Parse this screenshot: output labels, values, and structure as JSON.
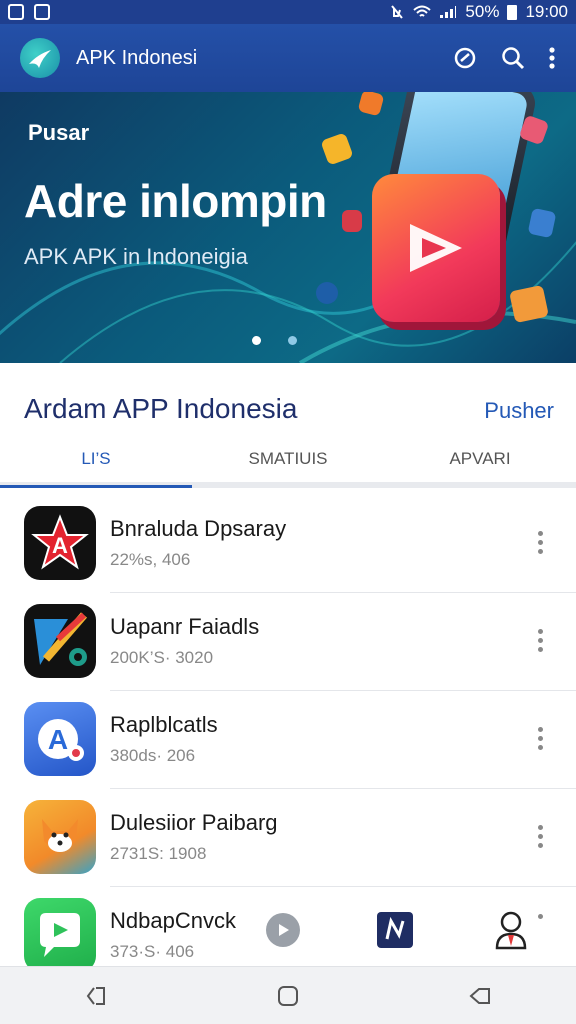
{
  "status_bar": {
    "battery": "50%",
    "time": "19:00"
  },
  "app_bar": {
    "title": "APK Indonesi"
  },
  "banner": {
    "eyebrow": "Pusar",
    "headline": "Adre inlompin",
    "subtitle": "APK APK in Indoneigia",
    "carousel_page": 1,
    "carousel_total": 2
  },
  "section": {
    "title": "Ardam APP Indonesia",
    "link": "Pusher"
  },
  "tabs": [
    {
      "label": "LI’S",
      "active": true
    },
    {
      "label": "SMATIUIS",
      "active": false
    },
    {
      "label": "APVARI",
      "active": false
    }
  ],
  "apps": [
    {
      "name": "Bnraluda Dpsaray",
      "meta": "22%s, 406",
      "icon": "star-a-icon"
    },
    {
      "name": "Uapanr Faiadls",
      "meta": "200K’S· 3020",
      "icon": "arrow-x-icon"
    },
    {
      "name": "Raplblcatls",
      "meta": "380ds· 206",
      "icon": "letter-a-icon"
    },
    {
      "name": "Dulesiior Paibarg",
      "meta": "2731S: 1908",
      "icon": "fox-icon"
    },
    {
      "name": "NdbapCnvck",
      "meta": "373·S· 406",
      "icon": "chat-bubble-icon"
    }
  ],
  "colors": {
    "app_bar": "#2450a8",
    "accent": "#2459b6",
    "section_title": "#1f2f6b"
  }
}
